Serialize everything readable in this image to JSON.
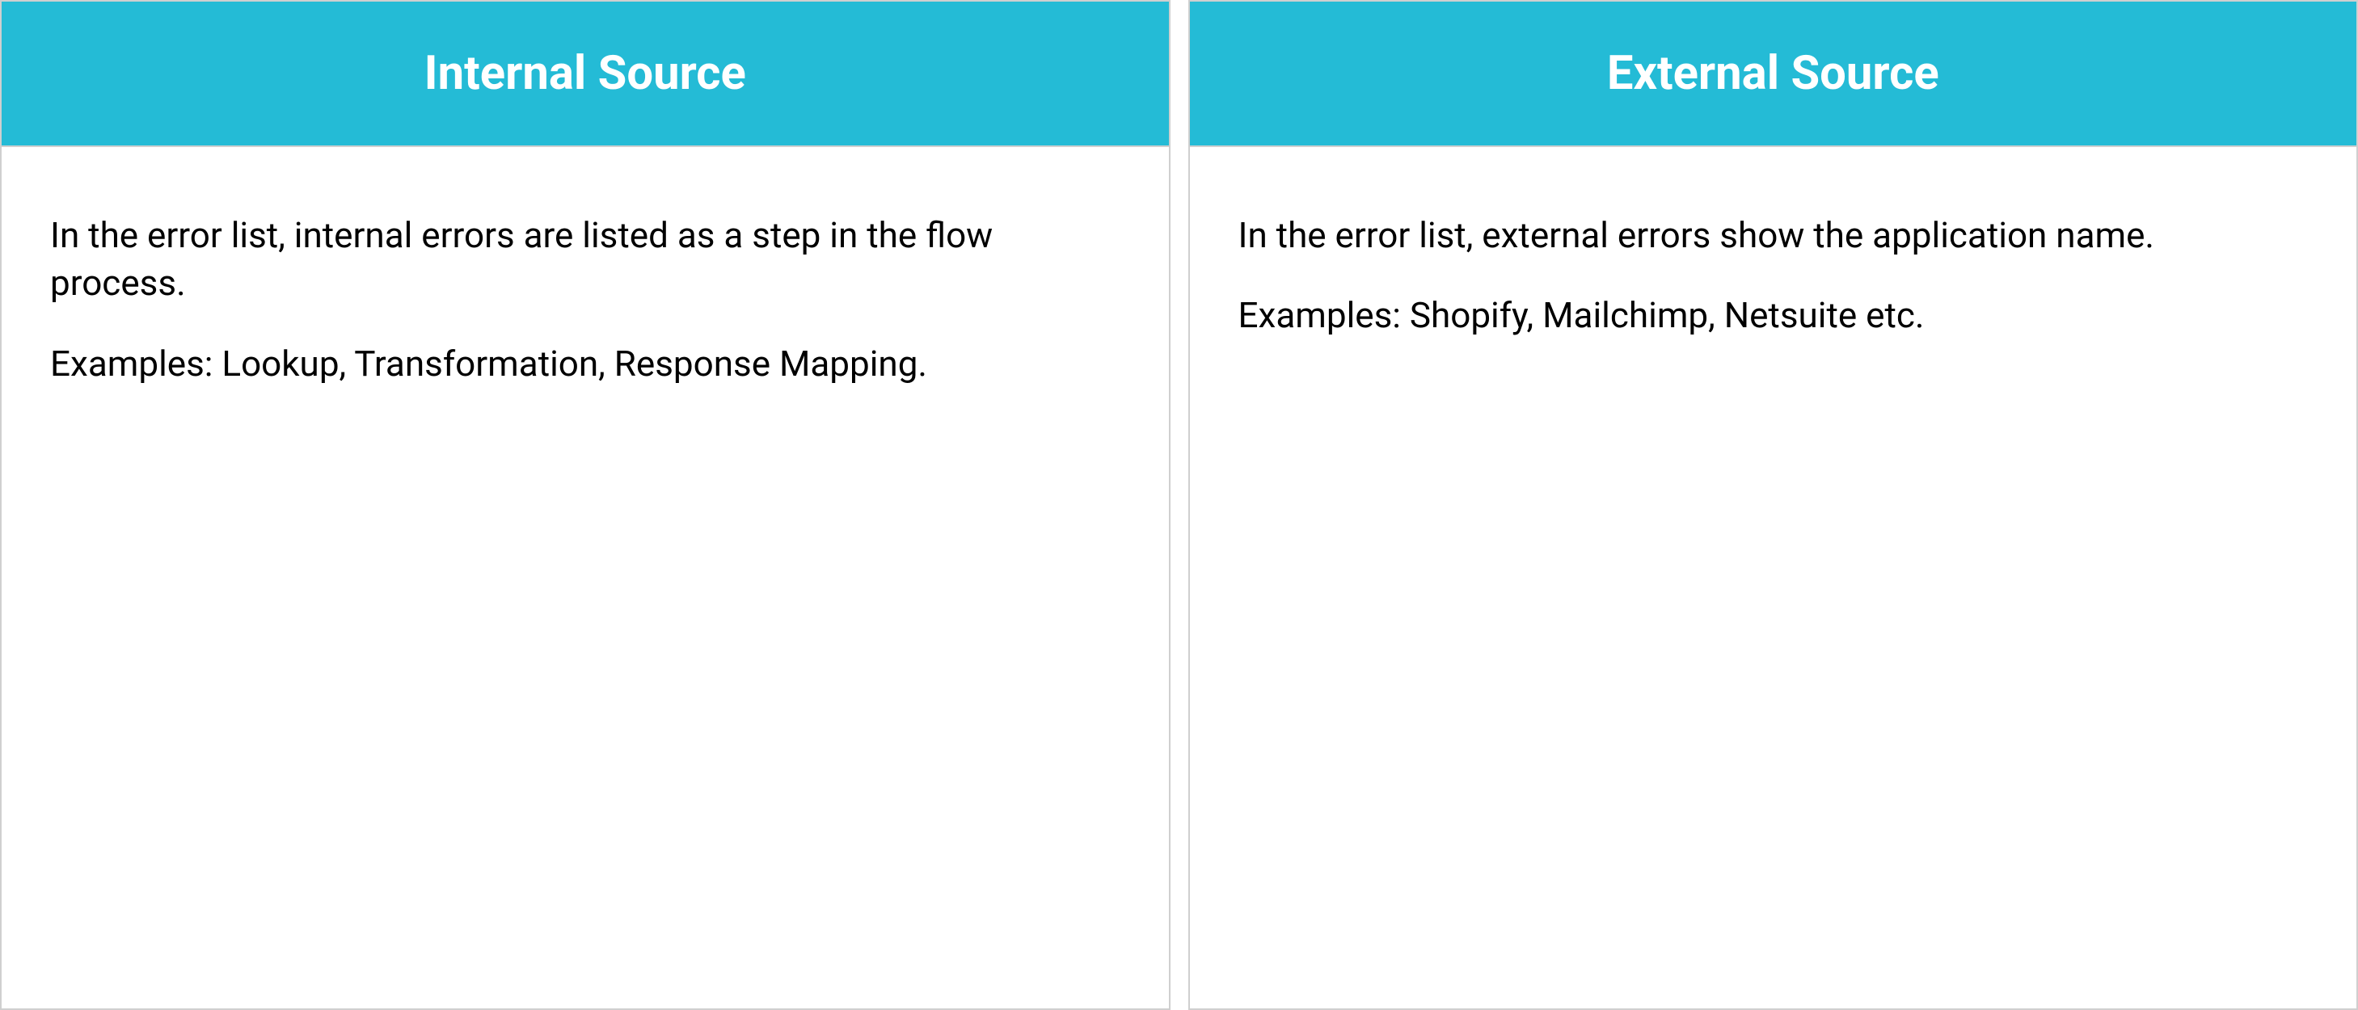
{
  "columns": [
    {
      "header": "Internal Source",
      "description": "In the error list, internal errors are listed as a step in the flow process.",
      "examples": "Examples: Lookup, Transformation, Response Mapping."
    },
    {
      "header": "External Source",
      "description": "In the error list, external errors show the application name.",
      "examples": "Examples: Shopify, Mailchimp, Netsuite etc."
    }
  ]
}
